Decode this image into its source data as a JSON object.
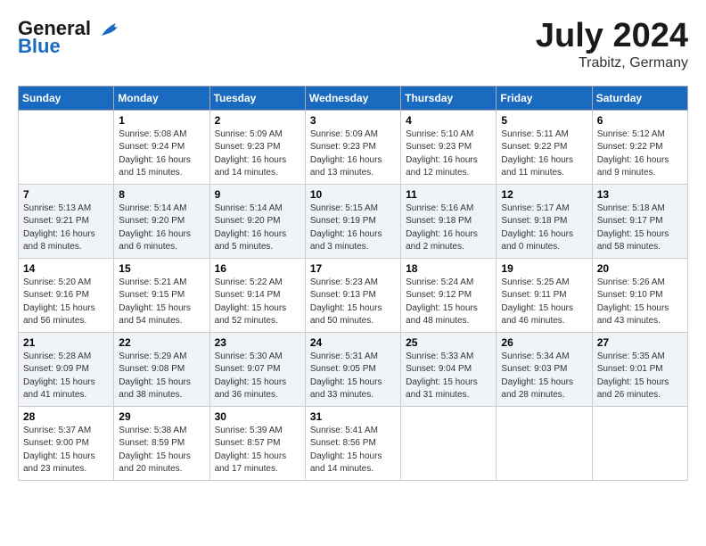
{
  "header": {
    "logo_line1": "General",
    "logo_line2": "Blue",
    "month_year": "July 2024",
    "location": "Trabitz, Germany"
  },
  "weekdays": [
    "Sunday",
    "Monday",
    "Tuesday",
    "Wednesday",
    "Thursday",
    "Friday",
    "Saturday"
  ],
  "weeks": [
    [
      {
        "day": "",
        "sunrise": "",
        "sunset": "",
        "daylight": ""
      },
      {
        "day": "1",
        "sunrise": "Sunrise: 5:08 AM",
        "sunset": "Sunset: 9:24 PM",
        "daylight": "Daylight: 16 hours and 15 minutes."
      },
      {
        "day": "2",
        "sunrise": "Sunrise: 5:09 AM",
        "sunset": "Sunset: 9:23 PM",
        "daylight": "Daylight: 16 hours and 14 minutes."
      },
      {
        "day": "3",
        "sunrise": "Sunrise: 5:09 AM",
        "sunset": "Sunset: 9:23 PM",
        "daylight": "Daylight: 16 hours and 13 minutes."
      },
      {
        "day": "4",
        "sunrise": "Sunrise: 5:10 AM",
        "sunset": "Sunset: 9:23 PM",
        "daylight": "Daylight: 16 hours and 12 minutes."
      },
      {
        "day": "5",
        "sunrise": "Sunrise: 5:11 AM",
        "sunset": "Sunset: 9:22 PM",
        "daylight": "Daylight: 16 hours and 11 minutes."
      },
      {
        "day": "6",
        "sunrise": "Sunrise: 5:12 AM",
        "sunset": "Sunset: 9:22 PM",
        "daylight": "Daylight: 16 hours and 9 minutes."
      }
    ],
    [
      {
        "day": "7",
        "sunrise": "Sunrise: 5:13 AM",
        "sunset": "Sunset: 9:21 PM",
        "daylight": "Daylight: 16 hours and 8 minutes."
      },
      {
        "day": "8",
        "sunrise": "Sunrise: 5:14 AM",
        "sunset": "Sunset: 9:20 PM",
        "daylight": "Daylight: 16 hours and 6 minutes."
      },
      {
        "day": "9",
        "sunrise": "Sunrise: 5:14 AM",
        "sunset": "Sunset: 9:20 PM",
        "daylight": "Daylight: 16 hours and 5 minutes."
      },
      {
        "day": "10",
        "sunrise": "Sunrise: 5:15 AM",
        "sunset": "Sunset: 9:19 PM",
        "daylight": "Daylight: 16 hours and 3 minutes."
      },
      {
        "day": "11",
        "sunrise": "Sunrise: 5:16 AM",
        "sunset": "Sunset: 9:18 PM",
        "daylight": "Daylight: 16 hours and 2 minutes."
      },
      {
        "day": "12",
        "sunrise": "Sunrise: 5:17 AM",
        "sunset": "Sunset: 9:18 PM",
        "daylight": "Daylight: 16 hours and 0 minutes."
      },
      {
        "day": "13",
        "sunrise": "Sunrise: 5:18 AM",
        "sunset": "Sunset: 9:17 PM",
        "daylight": "Daylight: 15 hours and 58 minutes."
      }
    ],
    [
      {
        "day": "14",
        "sunrise": "Sunrise: 5:20 AM",
        "sunset": "Sunset: 9:16 PM",
        "daylight": "Daylight: 15 hours and 56 minutes."
      },
      {
        "day": "15",
        "sunrise": "Sunrise: 5:21 AM",
        "sunset": "Sunset: 9:15 PM",
        "daylight": "Daylight: 15 hours and 54 minutes."
      },
      {
        "day": "16",
        "sunrise": "Sunrise: 5:22 AM",
        "sunset": "Sunset: 9:14 PM",
        "daylight": "Daylight: 15 hours and 52 minutes."
      },
      {
        "day": "17",
        "sunrise": "Sunrise: 5:23 AM",
        "sunset": "Sunset: 9:13 PM",
        "daylight": "Daylight: 15 hours and 50 minutes."
      },
      {
        "day": "18",
        "sunrise": "Sunrise: 5:24 AM",
        "sunset": "Sunset: 9:12 PM",
        "daylight": "Daylight: 15 hours and 48 minutes."
      },
      {
        "day": "19",
        "sunrise": "Sunrise: 5:25 AM",
        "sunset": "Sunset: 9:11 PM",
        "daylight": "Daylight: 15 hours and 46 minutes."
      },
      {
        "day": "20",
        "sunrise": "Sunrise: 5:26 AM",
        "sunset": "Sunset: 9:10 PM",
        "daylight": "Daylight: 15 hours and 43 minutes."
      }
    ],
    [
      {
        "day": "21",
        "sunrise": "Sunrise: 5:28 AM",
        "sunset": "Sunset: 9:09 PM",
        "daylight": "Daylight: 15 hours and 41 minutes."
      },
      {
        "day": "22",
        "sunrise": "Sunrise: 5:29 AM",
        "sunset": "Sunset: 9:08 PM",
        "daylight": "Daylight: 15 hours and 38 minutes."
      },
      {
        "day": "23",
        "sunrise": "Sunrise: 5:30 AM",
        "sunset": "Sunset: 9:07 PM",
        "daylight": "Daylight: 15 hours and 36 minutes."
      },
      {
        "day": "24",
        "sunrise": "Sunrise: 5:31 AM",
        "sunset": "Sunset: 9:05 PM",
        "daylight": "Daylight: 15 hours and 33 minutes."
      },
      {
        "day": "25",
        "sunrise": "Sunrise: 5:33 AM",
        "sunset": "Sunset: 9:04 PM",
        "daylight": "Daylight: 15 hours and 31 minutes."
      },
      {
        "day": "26",
        "sunrise": "Sunrise: 5:34 AM",
        "sunset": "Sunset: 9:03 PM",
        "daylight": "Daylight: 15 hours and 28 minutes."
      },
      {
        "day": "27",
        "sunrise": "Sunrise: 5:35 AM",
        "sunset": "Sunset: 9:01 PM",
        "daylight": "Daylight: 15 hours and 26 minutes."
      }
    ],
    [
      {
        "day": "28",
        "sunrise": "Sunrise: 5:37 AM",
        "sunset": "Sunset: 9:00 PM",
        "daylight": "Daylight: 15 hours and 23 minutes."
      },
      {
        "day": "29",
        "sunrise": "Sunrise: 5:38 AM",
        "sunset": "Sunset: 8:59 PM",
        "daylight": "Daylight: 15 hours and 20 minutes."
      },
      {
        "day": "30",
        "sunrise": "Sunrise: 5:39 AM",
        "sunset": "Sunset: 8:57 PM",
        "daylight": "Daylight: 15 hours and 17 minutes."
      },
      {
        "day": "31",
        "sunrise": "Sunrise: 5:41 AM",
        "sunset": "Sunset: 8:56 PM",
        "daylight": "Daylight: 15 hours and 14 minutes."
      },
      {
        "day": "",
        "sunrise": "",
        "sunset": "",
        "daylight": ""
      },
      {
        "day": "",
        "sunrise": "",
        "sunset": "",
        "daylight": ""
      },
      {
        "day": "",
        "sunrise": "",
        "sunset": "",
        "daylight": ""
      }
    ]
  ]
}
